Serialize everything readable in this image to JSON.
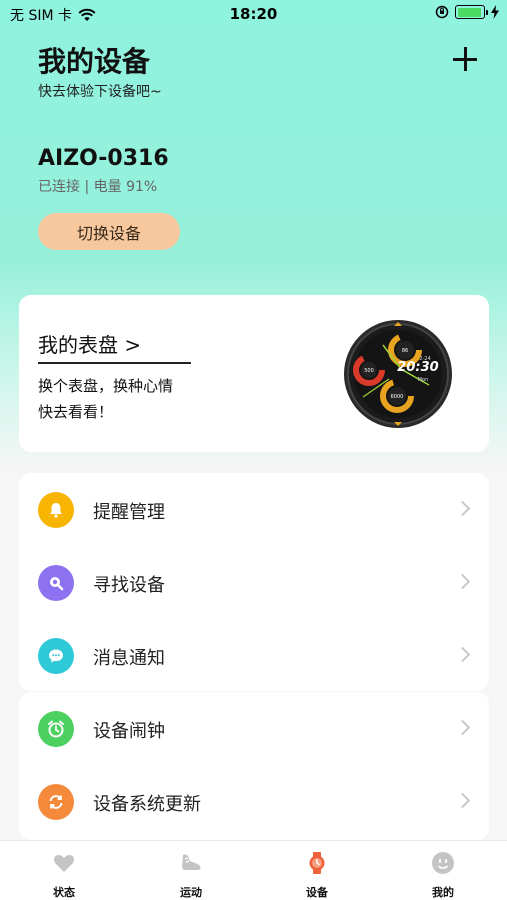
{
  "status_bar": {
    "carrier": "无 SIM 卡",
    "time": "18:20",
    "battery_level": 0.92
  },
  "header": {
    "title": "我的设备",
    "subtitle": "快去体验下设备吧~",
    "add_icon": "plus-icon"
  },
  "device": {
    "name": "AIZO-0316",
    "status": "已连接 | 电量 91%",
    "switch_label": "切换设备"
  },
  "dial_card": {
    "title": "我的表盘 >",
    "desc_line1": "换个表盘，换种心情",
    "desc_line2": "快去看看！",
    "watch_face": {
      "time": "20:30",
      "date": "2-24",
      "day": "Mon",
      "hr": "86",
      "cal": "500",
      "steps": "6000"
    }
  },
  "menu_group1": [
    {
      "label": "提醒管理",
      "icon": "bell-icon",
      "color": "#f7b500"
    },
    {
      "label": "寻找设备",
      "icon": "search-icon",
      "color": "#8c72f0"
    },
    {
      "label": "消息通知",
      "icon": "message-icon",
      "color": "#2fc8d6"
    }
  ],
  "menu_group2": [
    {
      "label": "设备闹钟",
      "icon": "alarm-clock-icon",
      "color": "#4cd060"
    },
    {
      "label": "设备系统更新",
      "icon": "refresh-icon",
      "color": "#f58a3a"
    }
  ],
  "tabs": [
    {
      "label": "状态",
      "icon": "heart-icon"
    },
    {
      "label": "运动",
      "icon": "shoe-icon"
    },
    {
      "label": "设备",
      "icon": "watch-icon",
      "active": true,
      "active_color": "#f0603a"
    },
    {
      "label": "我的",
      "icon": "face-icon"
    }
  ]
}
